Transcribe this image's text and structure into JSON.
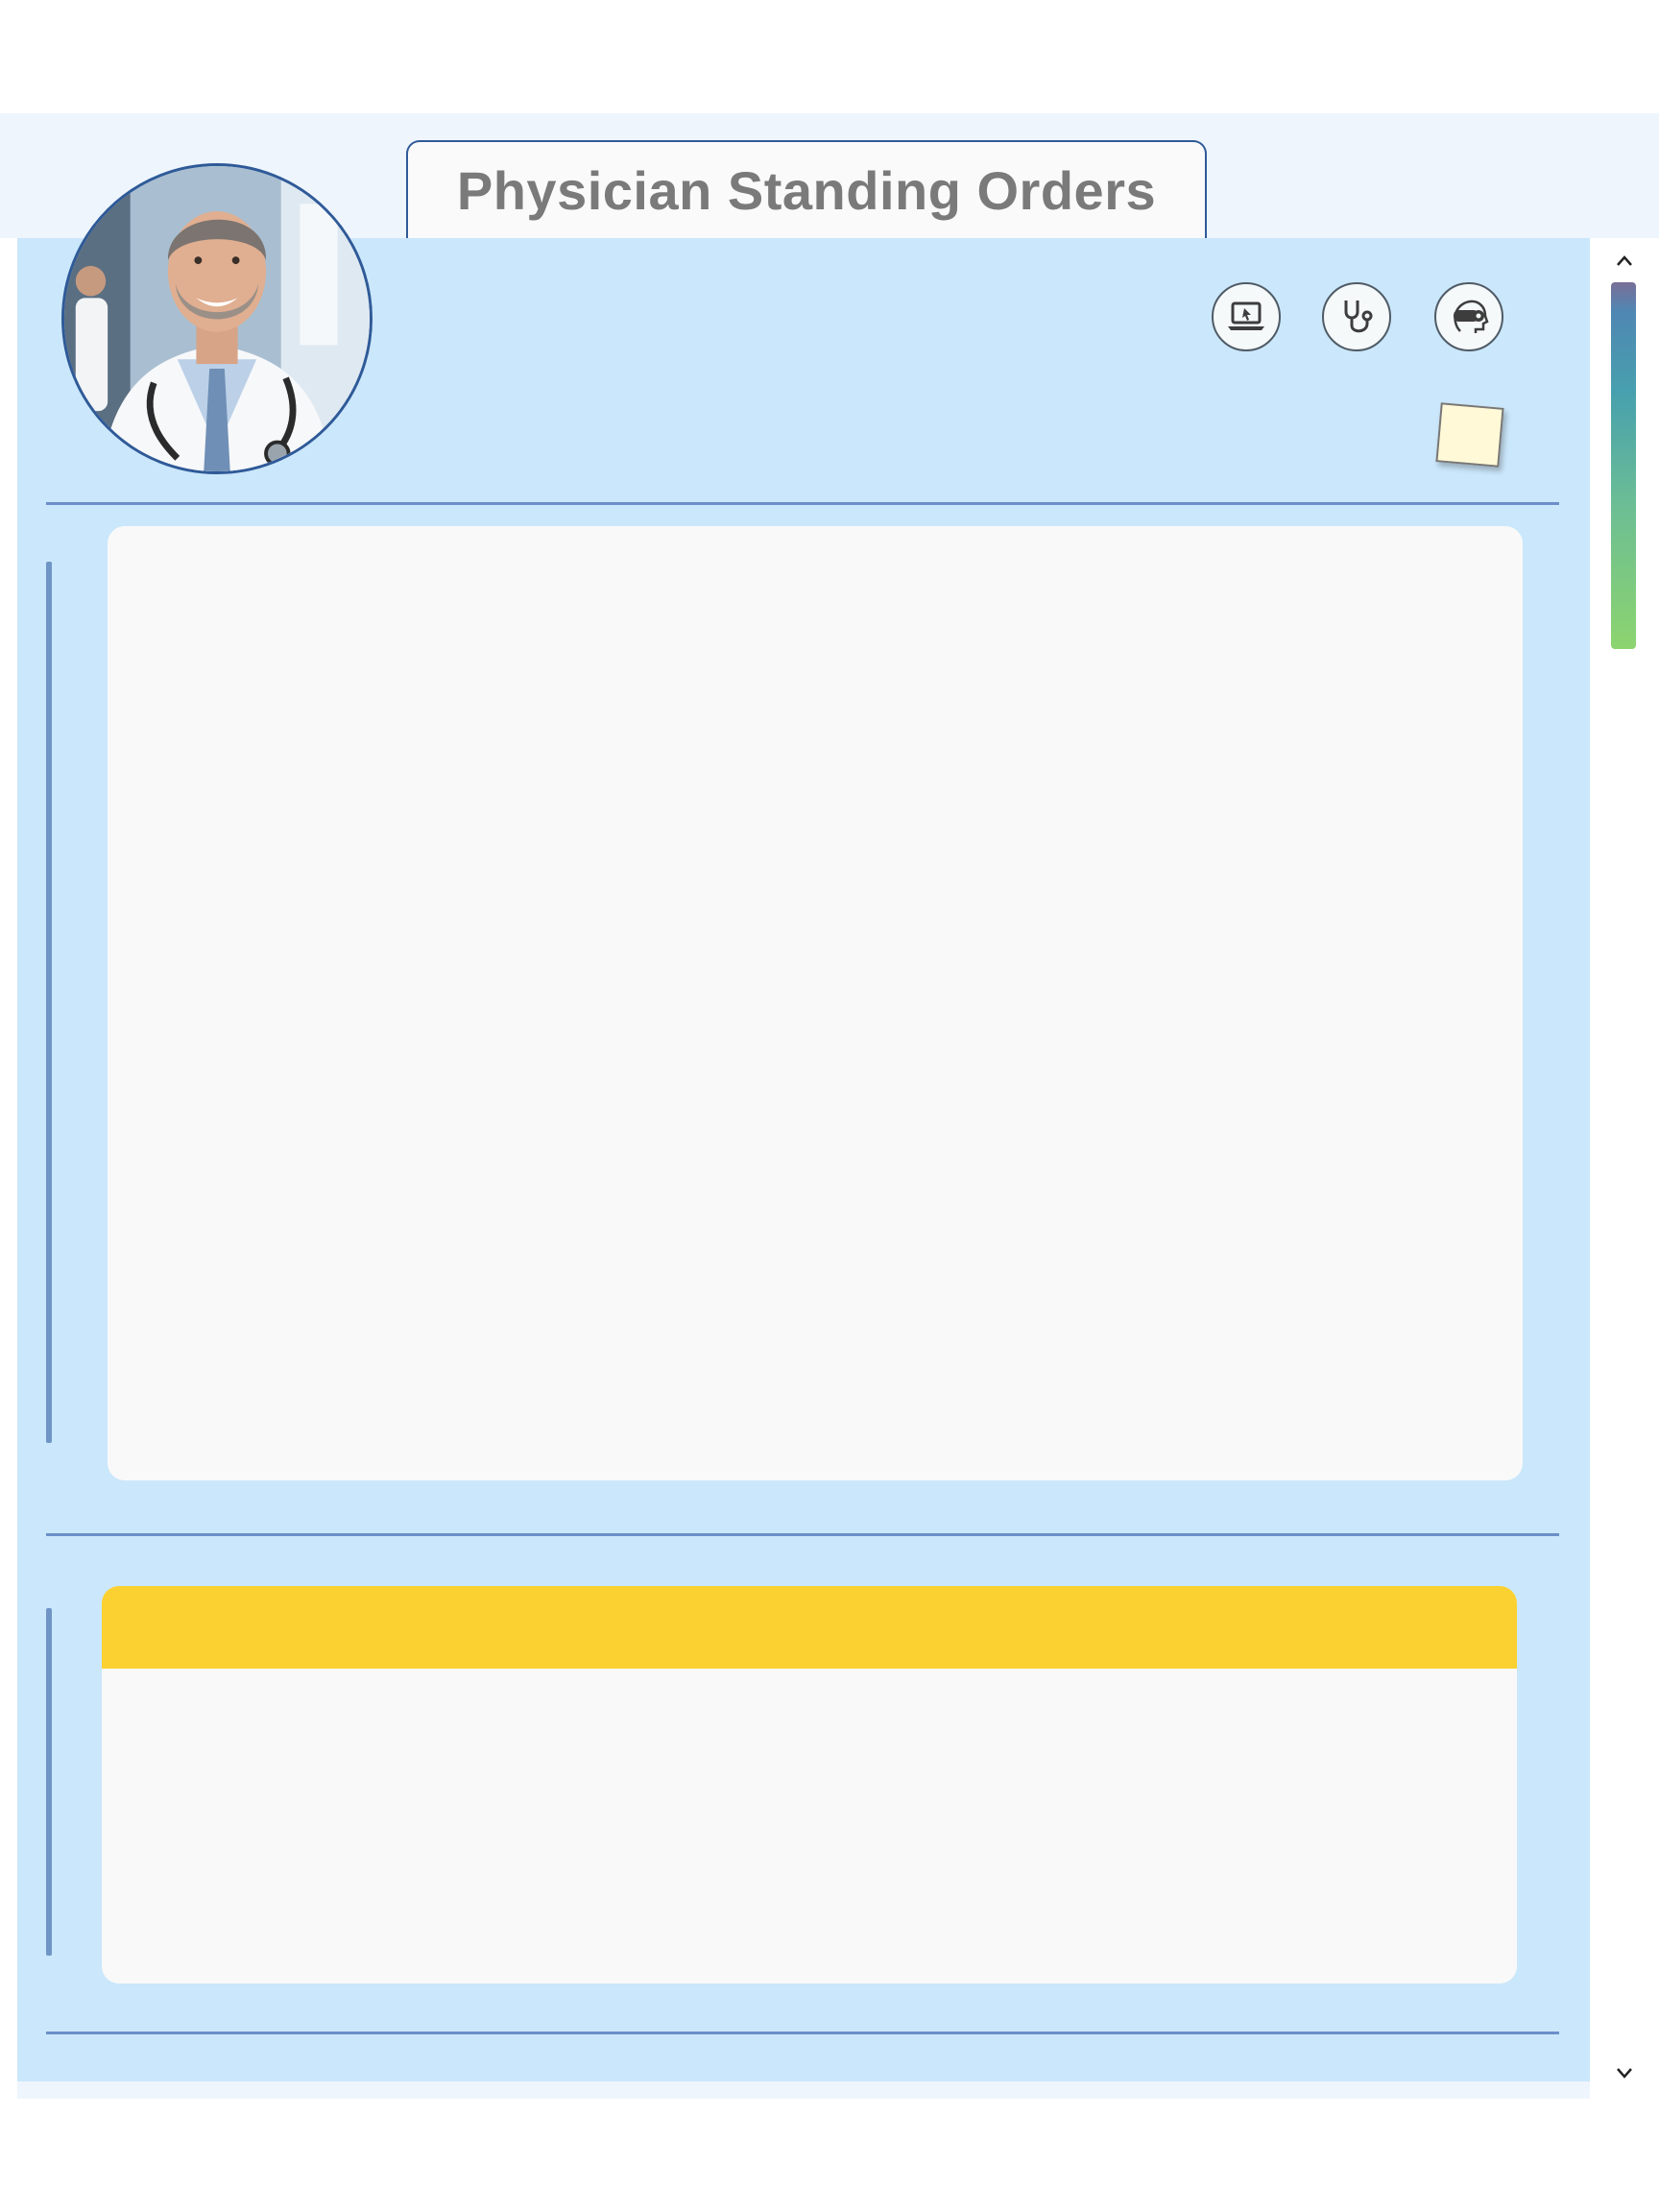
{
  "window": {
    "title": "Physician Standing Orders"
  },
  "header": {
    "avatar_alt": "Physician portrait",
    "toolbar": [
      {
        "name": "laptop-cursor-icon"
      },
      {
        "name": "stethoscope-icon"
      },
      {
        "name": "vr-headset-icon"
      }
    ],
    "sticky_note_icon": "sticky-note-icon"
  },
  "sections": [
    {
      "name": "orders-panel",
      "content": ""
    },
    {
      "name": "highlighted-panel",
      "header_color": "#fad130",
      "content": ""
    }
  ],
  "scrollbar": {
    "up_icon": "chevron-up-icon",
    "down_icon": "chevron-down-icon",
    "position": 0
  },
  "colors": {
    "panel_background": "#cbe7fb",
    "accent_border": "#2f5a98",
    "divider": "#6b8fca",
    "card_background": "#f9f9f9",
    "highlight": "#fad130"
  }
}
